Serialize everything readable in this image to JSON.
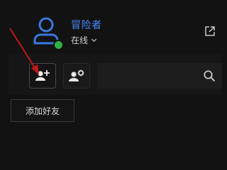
{
  "profile": {
    "name": "冒险者",
    "status": "在线",
    "online_color": "#2fb344",
    "avatar_icon": "user-avatar-icon"
  },
  "header": {
    "popout_icon": "external-link-icon"
  },
  "toolbar": {
    "add_friend_icon": "person-add-icon",
    "group_settings_icon": "person-gear-icon",
    "search_icon": "search-icon",
    "search_value": ""
  },
  "dropdown": {
    "add_friend_label": "添加好友"
  },
  "annotation": {
    "arrow_color": "#c01818"
  },
  "colors": {
    "background": "#121212",
    "accent": "#4a8cff"
  }
}
